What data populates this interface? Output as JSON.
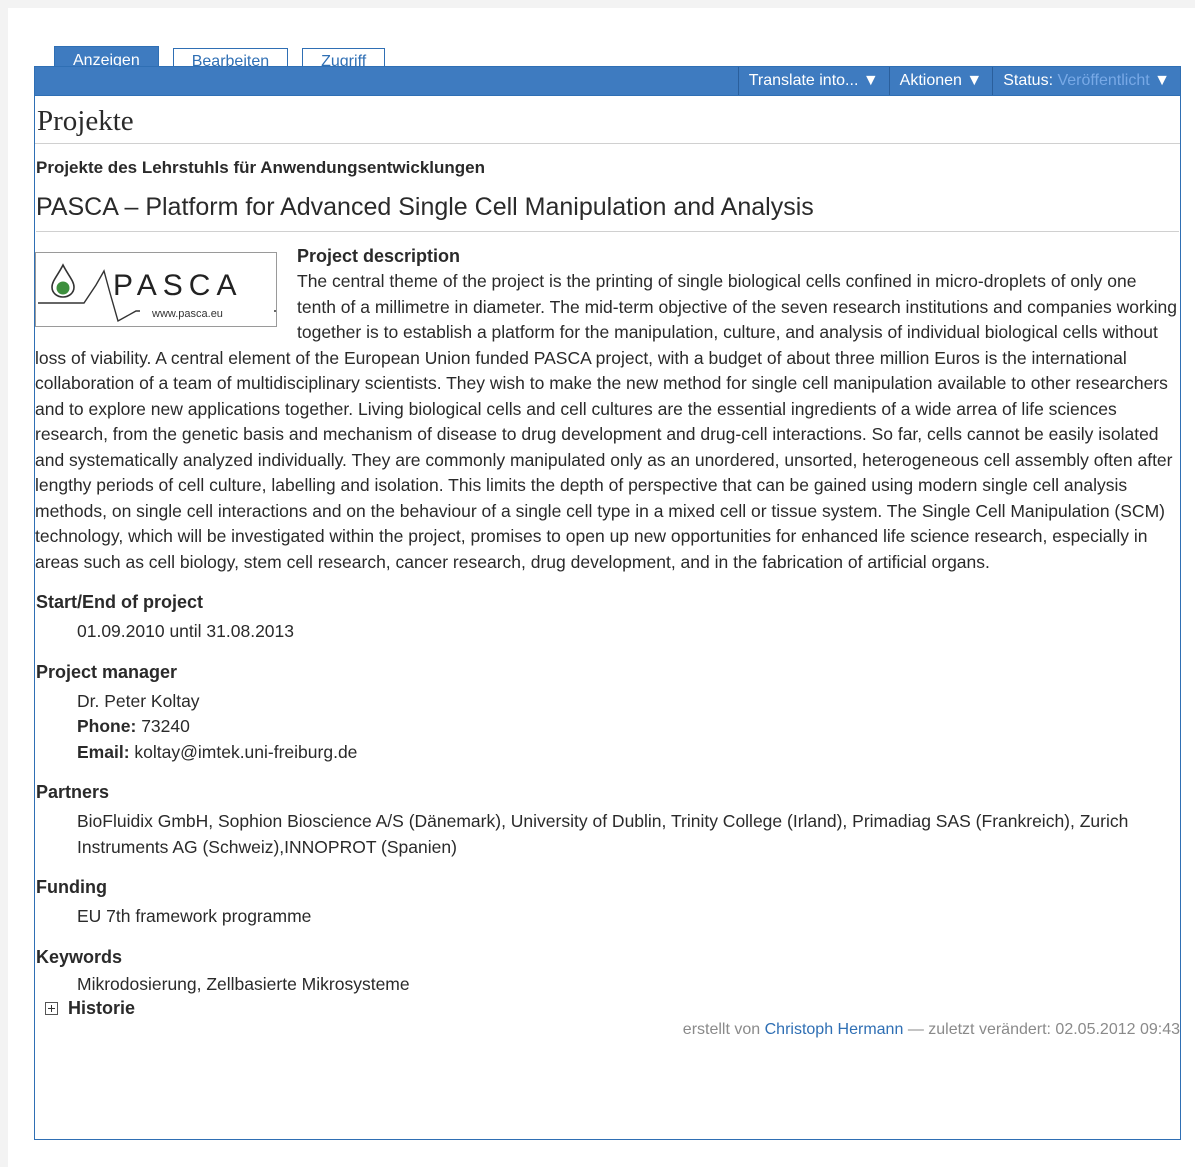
{
  "tabs": [
    {
      "label": "Anzeigen",
      "active": true
    },
    {
      "label": "Bearbeiten",
      "active": false
    },
    {
      "label": "Zugriff",
      "active": false
    }
  ],
  "actions": {
    "translate": "Translate into... ▼",
    "aktionen": "Aktionen ▼",
    "status_label": "Status:",
    "status_value": "Veröffentlicht",
    "status_arrow": "▼"
  },
  "page_title": "Projekte",
  "subtitle": "Projekte des Lehrstuhls für Anwendungsentwicklungen",
  "project_title": "PASCA – Platform for Advanced Single Cell Manipulation and Analysis",
  "logo": {
    "text": "PASCA",
    "url": "www.pasca.eu"
  },
  "description": {
    "heading": "Project description",
    "text": "The central theme of the project is the printing of single biological cells confined in micro-droplets of only one tenth of a millimetre in diameter. The mid-term objective of the seven research institutions and companies working together is to establish a platform for the manipulation, culture, and analysis of individual biological cells without loss of viability. A central element of the European Union funded PASCA project, with a budget of about three million Euros is the international collaboration of a team of multidisciplinary scientists. They wish to make the new method for single cell manipulation available to other researchers and to explore new applications together. Living biological cells and cell cultures are the essential ingredients of a wide arrea of life sciences research, from the genetic basis and mechanism of disease to drug development and drug-cell interactions. So far, cells cannot be easily isolated and systematically analyzed individually. They are commonly manipulated only as an unordered, unsorted, heterogeneous cell assembly often after lengthy periods of cell culture, labelling and isolation. This limits the depth of perspective that can be gained using modern single cell analysis methods, on single cell interactions and on the behaviour of a single cell type in a mixed cell or tissue system. The Single Cell Manipulation (SCM) technology, which will be investigated within the project, promises to open up new opportunities for enhanced life science research, especially in areas such as cell biology, stem cell research, cancer research, drug development, and in the fabrication of artificial organs."
  },
  "sections": {
    "start_end_label": "Start/End of project",
    "start_end_value": "01.09.2010 until 31.08.2013",
    "manager_label": "Project manager",
    "manager_name": "Dr. Peter Koltay",
    "phone_label": "Phone:",
    "phone_value": "73240",
    "email_label": "Email:",
    "email_value": "koltay@imtek.uni-freiburg.de",
    "partners_label": "Partners",
    "partners_value": "BioFluidix GmbH, Sophion Bioscience A/S (Dänemark), University of Dublin, Trinity College (Irland), Primadiag SAS (Frankreich), Zurich Instruments AG (Schweiz),INNOPROT (Spanien)",
    "funding_label": "Funding",
    "funding_value": "EU 7th framework programme",
    "keywords_label": "Keywords",
    "keywords_value": "Mikrodosierung, Zellbasierte Mikrosysteme"
  },
  "history_label": "Historie",
  "byline": {
    "prefix": "erstellt von",
    "author": "Christoph Hermann",
    "suffix": "— zuletzt verändert: 02.05.2012 09:43"
  }
}
